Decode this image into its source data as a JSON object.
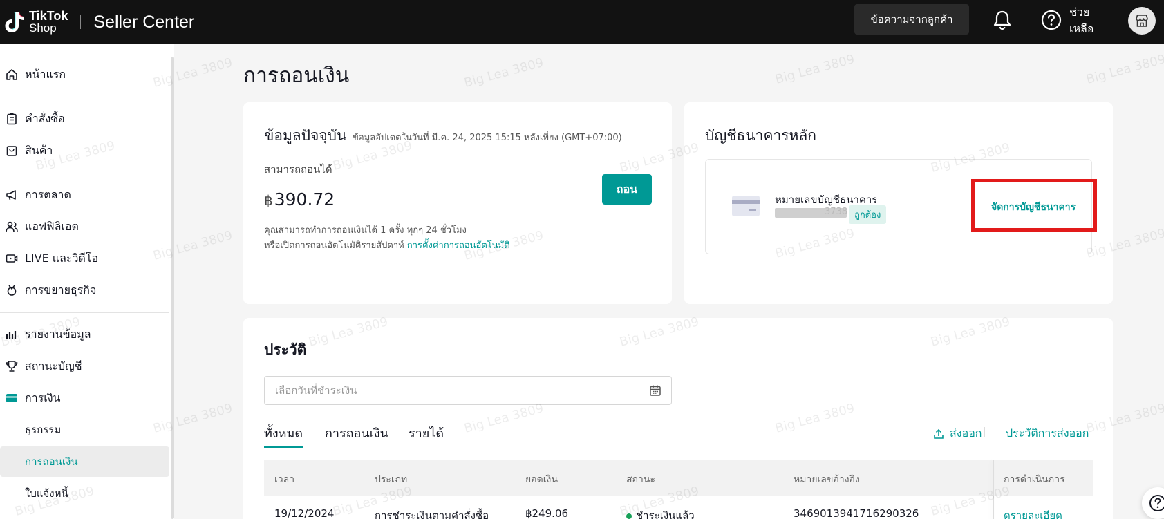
{
  "header": {
    "logo_line1": "TikTok",
    "logo_line2": "Shop",
    "brand_title": "Seller Center",
    "messages_button": "ข้อความจากลูกค้า",
    "help_label": "ช่วย\nเหลือ"
  },
  "sidebar": {
    "items": [
      {
        "label": "หน้าแรก",
        "icon": "home-icon"
      },
      {
        "label": "คำสั่งซื้อ",
        "icon": "clipboard-icon"
      },
      {
        "label": "สินค้า",
        "icon": "bag-icon"
      },
      {
        "label": "การตลาด",
        "icon": "megaphone-icon"
      },
      {
        "label": "แอฟฟิลิเอต",
        "icon": "people-icon"
      },
      {
        "label": "LIVE และวิดีโอ",
        "icon": "video-icon"
      },
      {
        "label": "การขยายธุรกิจ",
        "icon": "growth-icon"
      },
      {
        "label": "รายงานข้อมูล",
        "icon": "chart-icon"
      },
      {
        "label": "สถานะบัญชี",
        "icon": "trophy-icon"
      },
      {
        "label": "การเงิน",
        "icon": "wallet-icon"
      }
    ],
    "finance_sub": [
      {
        "label": "ธุรกรรม"
      },
      {
        "label": "การถอนเงิน"
      },
      {
        "label": "ใบแจ้งหนี้"
      }
    ]
  },
  "page": {
    "title": "การถอนเงิน"
  },
  "current_info": {
    "title": "ข้อมูลปัจจุบัน",
    "updated": "ข้อมูลอัปเดตในวันที่ มี.ค. 24, 2025 15:15 หลังเที่ยง (GMT+07:00)",
    "available_label": "สามารถถอนได้",
    "currency": "฿",
    "amount": "390.72",
    "withdraw_button": "ถอน",
    "note_line1": "คุณสามารถทำการถอนเงินได้ 1 ครั้ง ทุกๆ 24 ชั่วโมง",
    "note_line2": "หรือเปิดการถอนอัตโนมัติรายสัปดาห์",
    "auto_link": "การตั้งค่าการถอนอัตโนมัติ"
  },
  "bank": {
    "title": "บัญชีธนาคารหลัก",
    "account_label": "หมายเลขบัญชีธนาคาร",
    "account_tail": "3738",
    "status": "ถูกต้อง",
    "manage_link": "จัดการบัญชีธนาคาร"
  },
  "history": {
    "title": "ประวัติ",
    "date_placeholder": "เลือกวันที่ชำระเงิน",
    "tabs": [
      "ทั้งหมด",
      "การถอนเงิน",
      "รายได้"
    ],
    "export": "ส่งออก",
    "export_history": "ประวัติการส่งออก",
    "columns": [
      "เวลา",
      "ประเภท",
      "ยอดเงิน",
      "สถานะ",
      "หมายเลขอ้างอิง",
      "การดำเนินการ"
    ],
    "rows": [
      {
        "time": "19/12/2024",
        "type": "การชำระเงินตามคำสั่งซื้อ",
        "amount": "฿249.06",
        "status": "ชำระเงินแล้ว",
        "ref": "3469013941716290326",
        "action": "ดรายละเอียด"
      }
    ]
  },
  "watermark": "Big Lea 3809",
  "colors": {
    "accent": "#009995",
    "topbar": "#121212",
    "highlight": "#e21a1a"
  }
}
